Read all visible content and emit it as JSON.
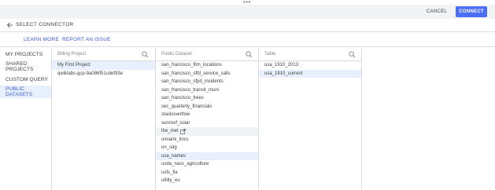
{
  "top": {
    "dots": "•••"
  },
  "header": {
    "cancel_label": "CANCEL",
    "connect_label": "CONNECT"
  },
  "title": {
    "text": "SELECT CONNECTOR",
    "icon": "arrow-left-icon"
  },
  "links": {
    "learn_more": "LEARN MORE",
    "report_issue": "REPORT AN ISSUE"
  },
  "nav": {
    "items": [
      {
        "label": "MY PROJECTS",
        "active": false
      },
      {
        "label": "SHARED PROJECTS",
        "active": false
      },
      {
        "label": "CUSTOM QUERY",
        "active": false
      },
      {
        "label": "PUBLIC DATASETS",
        "active": true
      }
    ]
  },
  "billing": {
    "header": "Billing Project",
    "items": [
      {
        "label": "My First Project",
        "selected": true
      },
      {
        "label": "qwiklabs-gcp-9a086f51cdef93e",
        "selected": false
      }
    ]
  },
  "dataset": {
    "header": "Public Dataset",
    "items": [
      {
        "label": "san_francisco_film_locations"
      },
      {
        "label": "san_francisco_sffd_service_calls"
      },
      {
        "label": "san_francisco_sfpd_incidents"
      },
      {
        "label": "san_francisco_transit_muni"
      },
      {
        "label": "san_francisco_trees"
      },
      {
        "label": "sec_quarterly_financials"
      },
      {
        "label": "stackoverflow"
      },
      {
        "label": "sunroof_solar"
      },
      {
        "label": "the_met",
        "hover": true,
        "external": true
      },
      {
        "label": "umiami_lincs"
      },
      {
        "label": "un_sdg"
      },
      {
        "label": "usa_names",
        "selected": true
      },
      {
        "label": "usda_nass_agriculture"
      },
      {
        "label": "usfs_fia"
      },
      {
        "label": "utility_eu"
      }
    ]
  },
  "table": {
    "header": "Table",
    "items": [
      {
        "label": "usa_1910_2013",
        "selected": false
      },
      {
        "label": "usa_1910_current",
        "selected": true
      }
    ]
  },
  "colors": {
    "accent": "#4c6ef5",
    "link": "#3a5bd9",
    "selected_bg": "#e8f0fe"
  }
}
